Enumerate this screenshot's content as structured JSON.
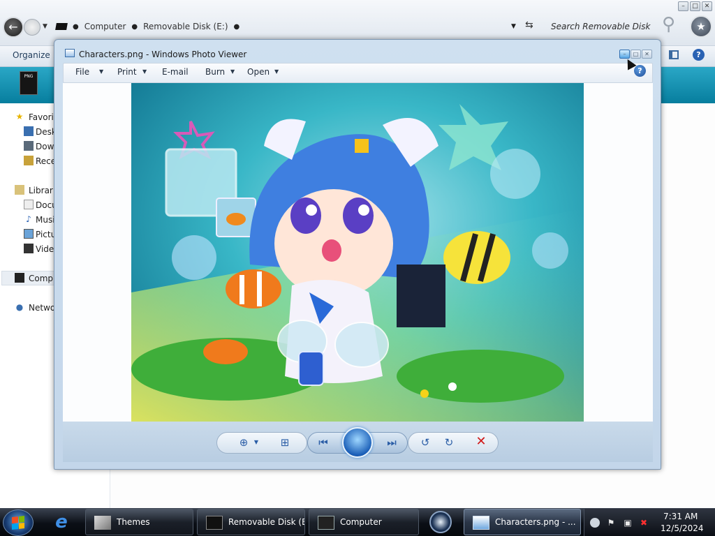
{
  "explorer": {
    "breadcrumb": [
      "Computer",
      "Removable Disk (E:)"
    ],
    "search_placeholder": "Search Removable Disk (E:)",
    "organize_label": "Organize",
    "nav": {
      "favorites": "Favorites",
      "desktop": "Desktop",
      "downloads": "Downloads",
      "recent": "Recent Places",
      "libraries": "Libraries",
      "documents": "Documents",
      "music": "Music",
      "pictures": "Pictures",
      "videos": "Videos",
      "computer": "Computer",
      "network": "Network"
    }
  },
  "viewer": {
    "title": "Characters.png - Windows Photo Viewer",
    "menu": [
      "File",
      "Print",
      "E-mail",
      "Burn",
      "Open"
    ]
  },
  "taskbar": {
    "buttons": [
      "Themes",
      "Removable Disk (E:)",
      "Computer",
      "Characters.png - ..."
    ],
    "clock_time": "7:31 AM",
    "clock_date": "12/5/2024"
  },
  "colors": {
    "banner": "#0a8fb0",
    "viewer_frame": "#c3d6ea",
    "taskbar": "#0b0f16",
    "delete_red": "#d01818"
  }
}
